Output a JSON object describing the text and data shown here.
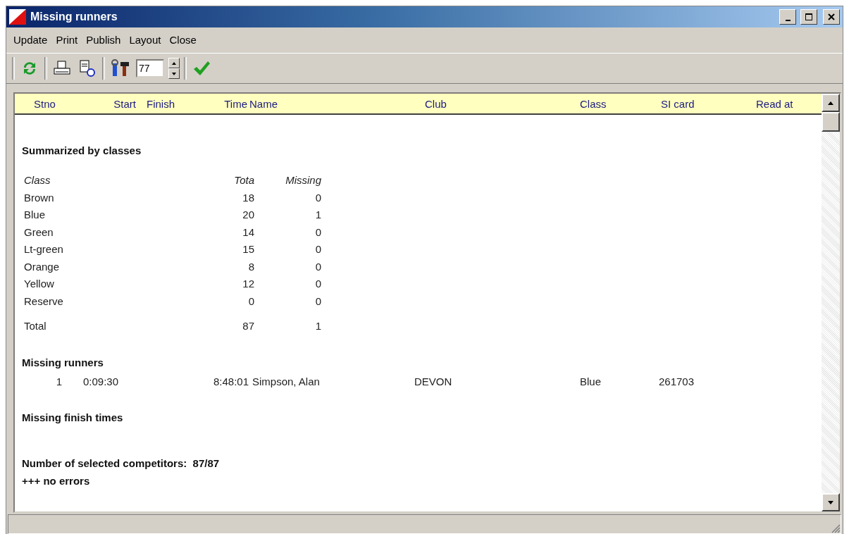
{
  "window": {
    "title": "Missing runners"
  },
  "menu": [
    "Update",
    "Print",
    "Publish",
    "Layout",
    "Close"
  ],
  "toolbar": {
    "count_field": {
      "value": "77"
    }
  },
  "columns": [
    "Stno",
    "Start",
    "Finish",
    "Time",
    "Name",
    "Club",
    "Class",
    "SI card",
    "Read at"
  ],
  "summary": {
    "heading": "Summarized by classes",
    "columns": [
      "Class",
      "Tota",
      "Missing"
    ],
    "rows": [
      [
        "Brown",
        "18",
        "0"
      ],
      [
        "Blue",
        "20",
        "1"
      ],
      [
        "Green",
        "14",
        "0"
      ],
      [
        "Lt-green",
        "15",
        "0"
      ],
      [
        "Orange",
        "8",
        "0"
      ],
      [
        "Yellow",
        "12",
        "0"
      ],
      [
        "Reserve",
        "0",
        "0"
      ]
    ],
    "total": [
      "Total",
      "87",
      "1"
    ]
  },
  "missing_runners": {
    "heading": "Missing runners",
    "rows": [
      [
        "1",
        "0:09:30",
        "",
        "8:48:01",
        "Simpson, Alan",
        "DEVON",
        "Blue",
        "261703",
        ""
      ]
    ]
  },
  "missing_finish": {
    "heading": "Missing finish times"
  },
  "footer": [
    "Number of selected competitors:  87/87",
    "+++ no errors"
  ]
}
